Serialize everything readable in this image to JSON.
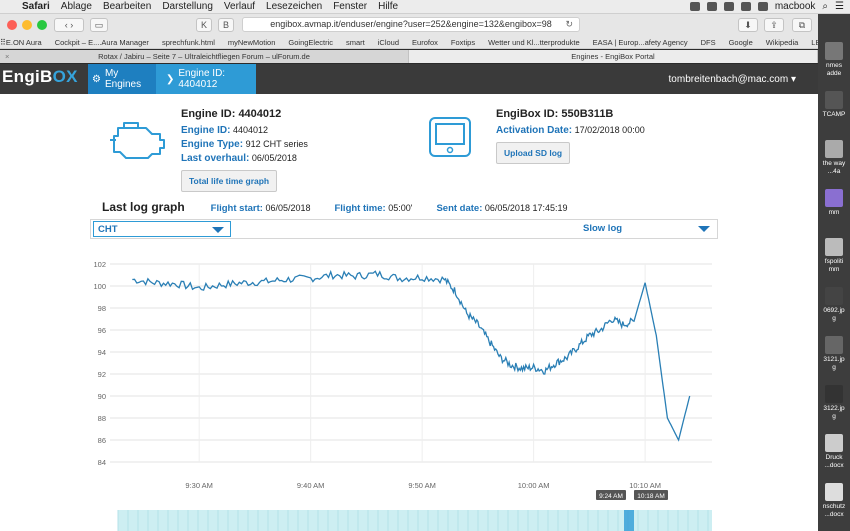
{
  "menubar": {
    "apple": "",
    "items": [
      "Safari",
      "Ablage",
      "Bearbeiten",
      "Darstellung",
      "Verlauf",
      "Lesezeichen",
      "Fenster",
      "Hilfe"
    ],
    "user": "macbook"
  },
  "browser": {
    "url": "engibox.avmap.it/enduser/engine?user=252&engine=132&engibox=98",
    "bookmarks": [
      "E.ON Aura",
      "Cockpit – E....Aura Manager",
      "sprechfunk.html",
      "myNewMotion",
      "GoingElectric",
      "smart",
      "iCloud",
      "Eurofox",
      "Foxtips",
      "Wetter und Kl...tterprodukte",
      "EASA | Europ...afety Agency",
      "DFS",
      "Google",
      "Wikipedia",
      "LBV",
      "maps"
    ],
    "tabs": [
      {
        "label": "Rotax / Jabiru – Seite 7 – Ultraleichtfliegen Forum – ulForum.de",
        "active": false
      },
      {
        "label": "Engines - EngiBox Portal",
        "active": true
      }
    ]
  },
  "header": {
    "logo_main": "EngiB",
    "logo_ox": "OX",
    "logo_sub": "PORTAL",
    "nav_my_engines": "My Engines",
    "nav_engine": "Engine ID: 4404012",
    "user": "tombreitenbach@mac.com"
  },
  "engine": {
    "title": "Engine ID: 4404012",
    "id_label": "Engine ID:",
    "id_value": "4404012",
    "type_label": "Engine Type:",
    "type_value": "912 CHT series",
    "overhaul_label": "Last overhaul:",
    "overhaul_value": "06/05/2018",
    "button": "Total life time graph"
  },
  "engibox": {
    "title": "EngiBox ID: 550B311B",
    "activation_label": "Activation Date:",
    "activation_value": "17/02/2018 00:00",
    "button": "Upload SD log"
  },
  "log": {
    "title": "Last log graph",
    "flight_start_label": "Flight start:",
    "flight_start_value": "06/05/2018",
    "flight_time_label": "Flight time:",
    "flight_time_value": "05:00'",
    "sent_date_label": "Sent date:",
    "sent_date_value": "06/05/2018 17:45:19",
    "param_select": "CHT",
    "log_select": "Slow log"
  },
  "desktop": {
    "items": [
      "nmes\nadde",
      "TCAMP",
      "the way\n...4a",
      "mm",
      "fspoliti\nmm",
      "0692.jp\ng",
      "3121.jp\ng",
      "3122.jp\ng",
      "Druck\n...docx",
      "nschutz\n...docx"
    ]
  },
  "chart_data": {
    "type": "line",
    "title": "",
    "xlabel": "",
    "ylabel": "",
    "ylim": [
      84,
      102
    ],
    "yticks": [
      84,
      86,
      88,
      90,
      92,
      94,
      96,
      98,
      100,
      102
    ],
    "xticks": [
      "9:30 AM",
      "9:40 AM",
      "9:50 AM",
      "10:00 AM",
      "10:10 AM"
    ],
    "series": [
      {
        "name": "",
        "x": [
          "9:24",
          "9:26",
          "9:28",
          "9:30",
          "9:32",
          "9:34",
          "9:36",
          "9:38",
          "9:40",
          "9:42",
          "9:44",
          "9:46",
          "9:48",
          "9:50",
          "9:52",
          "9:53",
          "9:54",
          "9:55",
          "9:56",
          "9:57",
          "9:58",
          "9:59",
          "10:00",
          "10:01",
          "10:02",
          "10:03",
          "10:04",
          "10:05",
          "10:06",
          "10:07",
          "10:08",
          "10:09",
          "10:10",
          "10:11",
          "10:12",
          "10:13",
          "10:14"
        ],
        "values": [
          100.6,
          100.3,
          100.2,
          99.8,
          100.1,
          100.3,
          100.4,
          100.6,
          100.7,
          101.0,
          100.9,
          101.1,
          100.7,
          100.8,
          100.6,
          99.5,
          97.5,
          96.5,
          95.0,
          93.5,
          92.8,
          92.5,
          92.6,
          92.3,
          93.0,
          93.5,
          94.5,
          95.5,
          96.0,
          97.0,
          96.5,
          96.8,
          100.3,
          95.5,
          88.0,
          86.0,
          90.0
        ]
      }
    ],
    "annotations": [
      "9:24 AM",
      "10:18 AM"
    ]
  }
}
